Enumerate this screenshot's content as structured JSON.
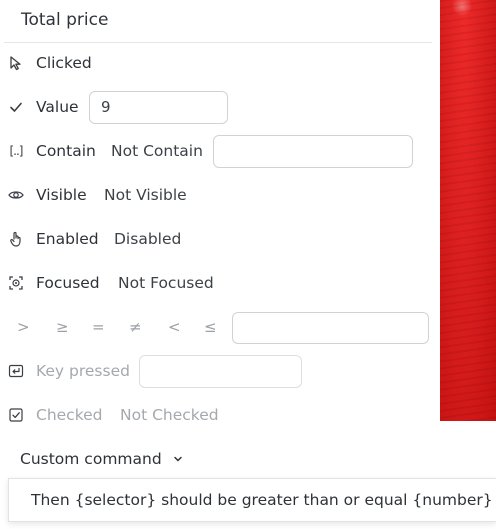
{
  "header": {
    "title": "Total price"
  },
  "rows": {
    "clicked": {
      "label": "Clicked",
      "icon": "cursor-icon"
    },
    "value": {
      "label": "Value",
      "input_value": "9",
      "icon": "check-icon"
    },
    "contain": {
      "label": "Contain",
      "alt": "Not Contain",
      "input_value": "",
      "icon": "contain-brackets-icon"
    },
    "visible": {
      "label": "Visible",
      "alt": "Not Visible",
      "icon": "eye-icon"
    },
    "enabled": {
      "label": "Enabled",
      "alt": "Disabled",
      "icon": "hand-pointer-icon"
    },
    "focused": {
      "label": "Focused",
      "alt": "Not Focused",
      "icon": "focus-target-icon"
    },
    "compare": {
      "operators": [
        ">",
        "≥",
        "=",
        "≠",
        "<",
        "≤"
      ],
      "input_value": ""
    },
    "key": {
      "label": "Key pressed",
      "input_value": "",
      "icon": "enter-key-icon"
    },
    "checked": {
      "label": "Checked",
      "alt": "Not Checked",
      "icon": "checkbox-icon"
    }
  },
  "custom": {
    "label": "Custom command",
    "icon": "chevron-down-icon"
  },
  "tooltip": {
    "text": "Then {selector} should be greater than or equal {number}"
  }
}
